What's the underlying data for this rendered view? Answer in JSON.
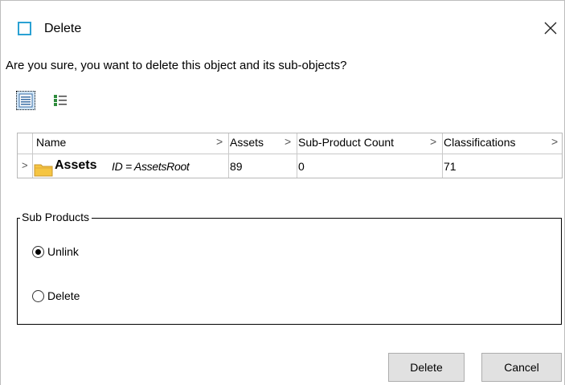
{
  "window": {
    "title": "Delete",
    "message": "Are you sure, you want to delete this object and its sub-objects?"
  },
  "view_toggle": {
    "items": [
      {
        "icon": "details-list-icon",
        "active": true
      },
      {
        "icon": "grouped-list-icon",
        "active": false
      }
    ]
  },
  "table": {
    "headers": [
      "Name",
      "Assets",
      "Sub-Product Count",
      "Classifications"
    ],
    "rows": [
      {
        "name": "Assets",
        "id_text": "ID = AssetsRoot",
        "assets": "89",
        "sub_product_count": "0",
        "classifications": "71"
      }
    ],
    "header_arrow": ">",
    "expander": ">"
  },
  "sub_products": {
    "title": "Sub Products",
    "options": [
      {
        "label": "Unlink",
        "selected": true
      },
      {
        "label": "Delete",
        "selected": false
      }
    ]
  },
  "buttons": {
    "delete_label": "Delete",
    "cancel_label": "Cancel"
  },
  "colors": {
    "title_icon": "#2aa1d3",
    "folder": "#f5c542",
    "button_bg": "#e1e1e1"
  }
}
